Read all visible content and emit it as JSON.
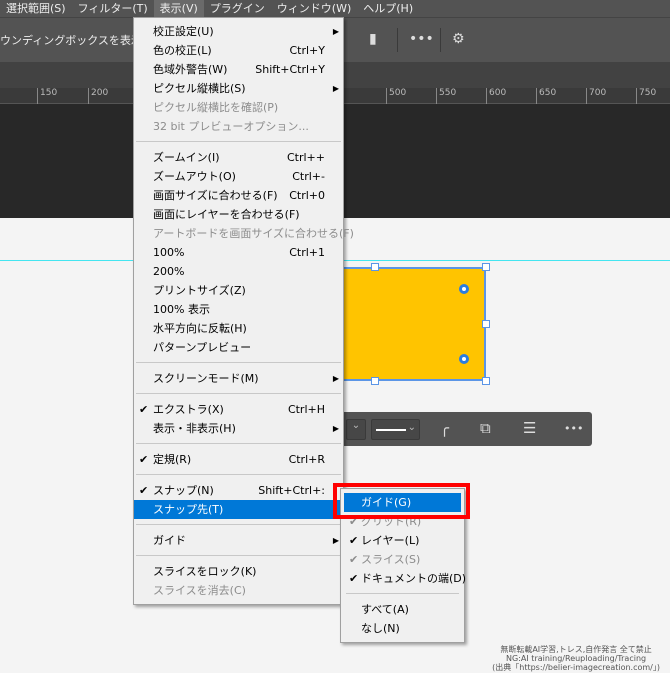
{
  "menubar": [
    "選択範囲(S)",
    "フィルター(T)",
    "表示(V)",
    "プラグイン",
    "ウィンドウ(W)",
    "ヘルプ(H)"
  ],
  "active_menu": "表示(V)",
  "options": {
    "bounding_box": "ウンディングボックスを表示"
  },
  "ruler": [
    "150",
    "200",
    "500",
    "550",
    "600",
    "650",
    "700",
    "750"
  ],
  "view_menu": [
    {
      "label": "校正設定(U)",
      "sub": true
    },
    {
      "label": "色の校正(L)",
      "shortcut": "Ctrl+Y"
    },
    {
      "label": "色域外警告(W)",
      "shortcut": "Shift+Ctrl+Y"
    },
    {
      "label": "ピクセル縦横比(S)",
      "sub": true
    },
    {
      "label": "ピクセル縦横比を確認(P)",
      "disabled": true
    },
    {
      "label": "32 bit プレビューオプション...",
      "disabled": true
    },
    {
      "sep": true
    },
    {
      "label": "ズームイン(I)",
      "shortcut": "Ctrl++"
    },
    {
      "label": "ズームアウト(O)",
      "shortcut": "Ctrl+-"
    },
    {
      "label": "画面サイズに合わせる(F)",
      "shortcut": "Ctrl+0"
    },
    {
      "label": "画面にレイヤーを合わせる(F)"
    },
    {
      "label": "アートボードを画面サイズに合わせる(F)",
      "disabled": true
    },
    {
      "label": "100%",
      "shortcut": "Ctrl+1"
    },
    {
      "label": "200%"
    },
    {
      "label": "プリントサイズ(Z)"
    },
    {
      "label": "100% 表示"
    },
    {
      "label": "水平方向に反転(H)"
    },
    {
      "label": "パターンプレビュー"
    },
    {
      "sep": true
    },
    {
      "label": "スクリーンモード(M)",
      "sub": true
    },
    {
      "sep": true
    },
    {
      "label": "エクストラ(X)",
      "shortcut": "Ctrl+H",
      "checked": true
    },
    {
      "label": "表示・非表示(H)",
      "sub": true
    },
    {
      "sep": true
    },
    {
      "label": "定規(R)",
      "shortcut": "Ctrl+R",
      "checked": true
    },
    {
      "sep": true
    },
    {
      "label": "スナップ(N)",
      "shortcut": "Shift+Ctrl+:",
      "checked": true
    },
    {
      "label": "スナップ先(T)",
      "highlighted": true
    },
    {
      "sep": true
    },
    {
      "label": "ガイド",
      "sub": true
    },
    {
      "sep": true
    },
    {
      "label": "スライスをロック(K)"
    },
    {
      "label": "スライスを消去(C)",
      "disabled": true
    }
  ],
  "snap_menu": [
    {
      "label": "ガイド(G)",
      "highlighted": true
    },
    {
      "label": "グリッド(R)",
      "disabled": true,
      "checked": true
    },
    {
      "label": "レイヤー(L)",
      "checked": true
    },
    {
      "label": "スライス(S)",
      "disabled": true,
      "checked": true
    },
    {
      "label": "ドキュメントの端(D)",
      "checked": true
    },
    {
      "sep": true
    },
    {
      "label": "すべて(A)"
    },
    {
      "label": "なし(N)"
    }
  ],
  "shape_fill": "#ffc400",
  "highlight_color": "#0078d7",
  "watermark": [
    "無断転載AI学習,トレス,自作発言 全て禁止",
    "NG:AI training/Reuploading/Tracing",
    "(出典「https://belier-imagecreation.com/」)"
  ]
}
